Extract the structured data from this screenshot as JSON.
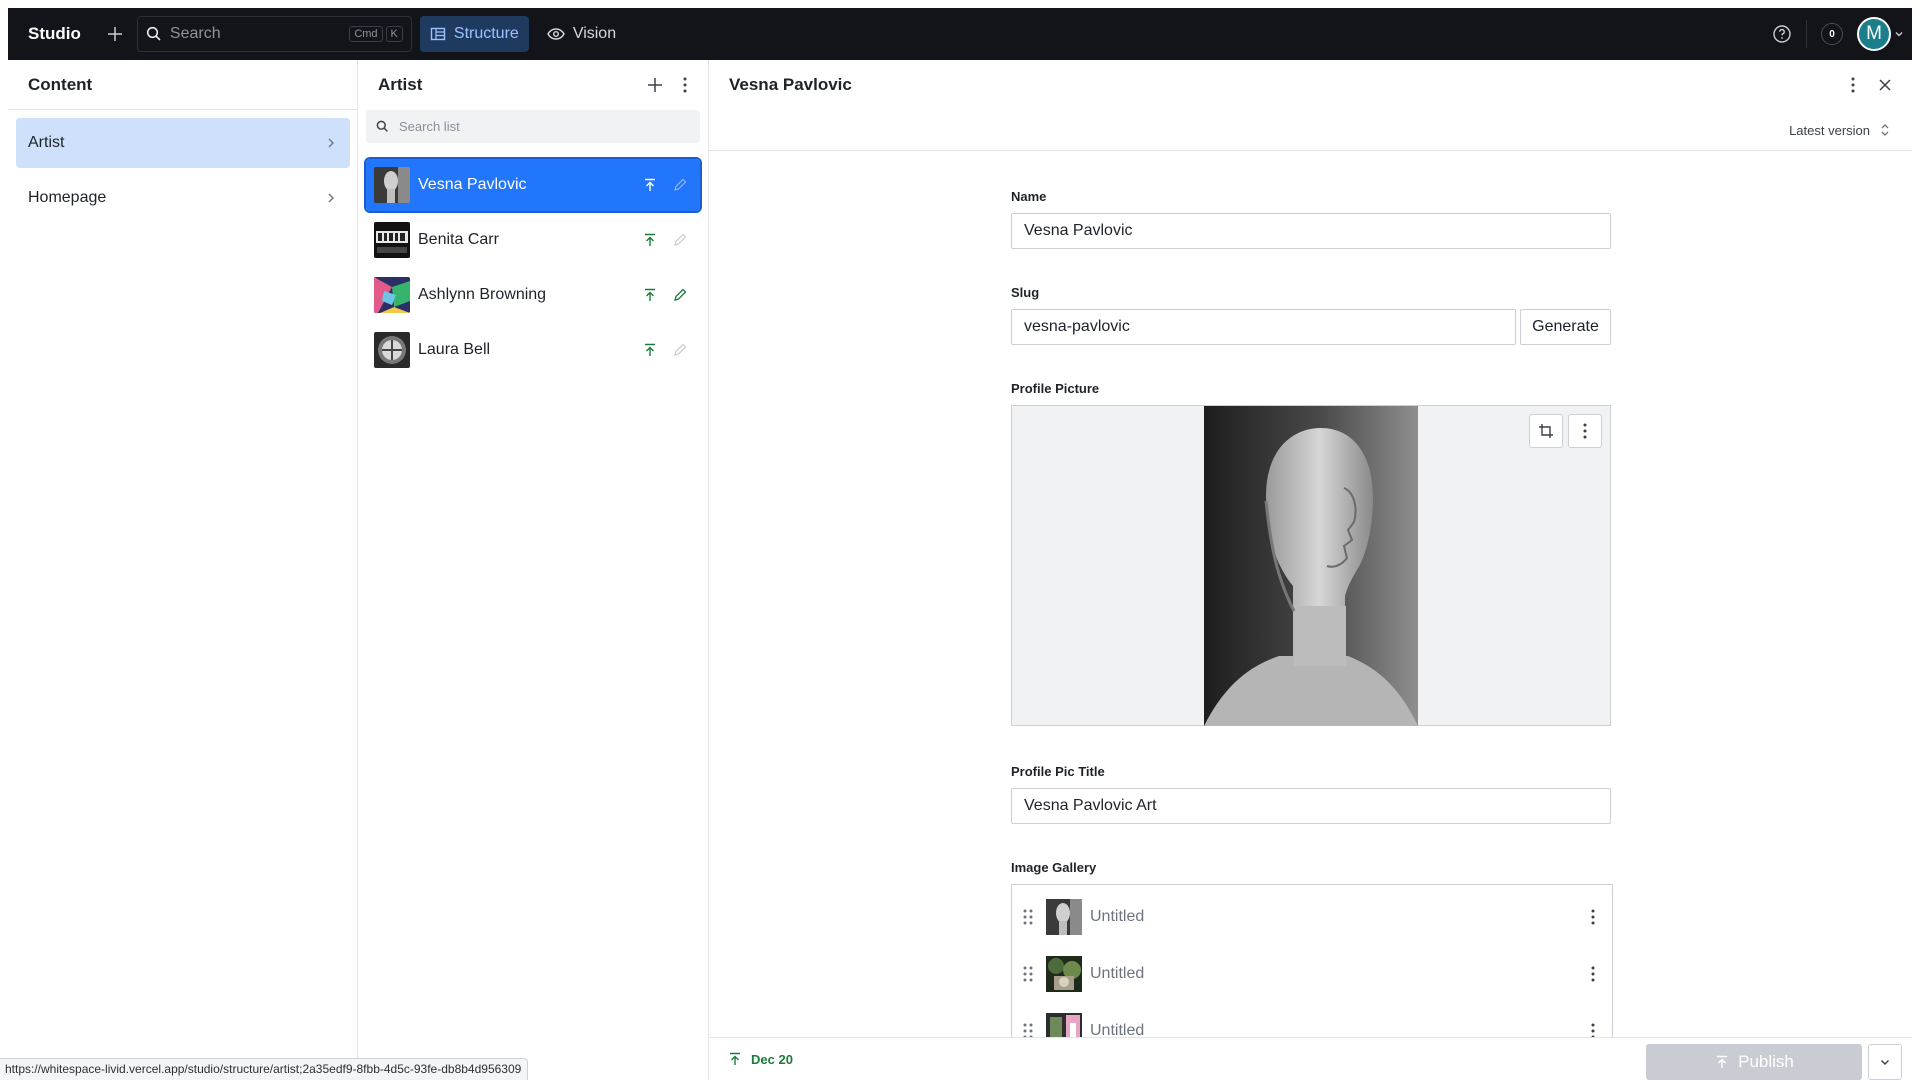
{
  "topbar": {
    "brand": "Studio",
    "search_placeholder": "Search",
    "shortcut_cmd": "Cmd",
    "shortcut_key": "K",
    "tools": [
      {
        "label": "Structure",
        "icon": "structure-icon",
        "active": true
      },
      {
        "label": "Vision",
        "icon": "eye-icon",
        "active": false
      }
    ],
    "notification_count": "0",
    "avatar_initial": "M"
  },
  "content_pane": {
    "title": "Content",
    "items": [
      {
        "label": "Artist",
        "selected": true
      },
      {
        "label": "Homepage",
        "selected": false
      }
    ]
  },
  "artist_pane": {
    "title": "Artist",
    "search_placeholder": "Search list",
    "documents": [
      {
        "name": "Vesna Pavlovic",
        "selected": true,
        "thumb": "sculpture"
      },
      {
        "name": "Benita Carr",
        "selected": false,
        "thumb": "text-art"
      },
      {
        "name": "Ashlynn Browning",
        "selected": false,
        "thumb": "colorful"
      },
      {
        "name": "Laura Bell",
        "selected": false,
        "thumb": "circle-bw"
      }
    ]
  },
  "document": {
    "title": "Vesna Pavlovic",
    "version_label": "Latest version",
    "fields": {
      "name_label": "Name",
      "name_value": "Vesna Pavlovic",
      "slug_label": "Slug",
      "slug_value": "vesna-pavlovic",
      "generate_label": "Generate",
      "profile_picture_label": "Profile Picture",
      "profile_pic_title_label": "Profile Pic Title",
      "profile_pic_title_value": "Vesna Pavlovic Art",
      "image_gallery_label": "Image Gallery"
    },
    "gallery": [
      {
        "title": "Untitled",
        "thumb": "sculpture"
      },
      {
        "title": "Untitled",
        "thumb": "green"
      },
      {
        "title": "Untitled",
        "thumb": "pink"
      }
    ],
    "footer": {
      "published_date": "Dec 20",
      "publish_label": "Publish"
    }
  },
  "status_url": "https://whitespace-livid.vercel.app/studio/structure/artist;2a35edf9-8fbb-4d5c-93fe-db8b4d956309",
  "colors": {
    "accent": "#2276fc",
    "selected_nav": "#cfe0fb",
    "published_green": "#1d7a3c",
    "topbar_bg": "#121419"
  }
}
